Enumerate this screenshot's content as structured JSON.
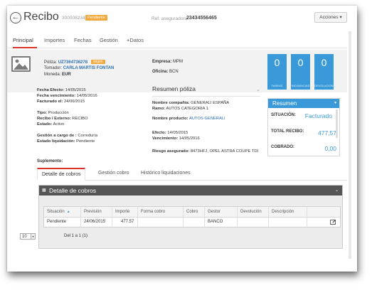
{
  "header": {
    "back_glyph": "←",
    "title": "Recibo",
    "doc_id": "3000082346",
    "state_badge": "Pendiente",
    "ref_label": "Ref. aseguradora",
    "ref_value": "23434556465",
    "actions_label": "Acciones"
  },
  "tabs": [
    {
      "label": "Principal",
      "active": true
    },
    {
      "label": "Importes",
      "active": false
    },
    {
      "label": "Fechas",
      "active": false
    },
    {
      "label": "Gestión",
      "active": false
    },
    {
      "label": "+Datos",
      "active": false
    }
  ],
  "summary": {
    "poliza_label": "Póliza:",
    "poliza_value": "UZ7364736278",
    "poliza_badge": "origen",
    "tomador_label": "Tomador:",
    "tomador_value": "CARLA MARTIS FONTAN",
    "moneda_label": "Moneda:",
    "moneda_value": "EUR",
    "empresa_label": "Empresa:",
    "empresa_value": "MPM",
    "oficina_label": "Oficina:",
    "oficina_value": "BCN",
    "tiles": [
      {
        "value": "0",
        "caption": "TAREAS"
      },
      {
        "value": "0",
        "caption": "INCIDENCIAS"
      },
      {
        "value": "0",
        "caption": "DEVOLUCIONES"
      }
    ]
  },
  "dates": {
    "efecto_label": "Fecha Efecto:",
    "efecto_value": "14/05/2015",
    "vencimiento_label": "Fecha vencimiento:",
    "vencimiento_value": "14/05/2016",
    "facturado_label": "Facturado el:",
    "facturado_value": "24/06/2015"
  },
  "status": {
    "tipo_label": "Tipo:",
    "tipo_value": "Producción",
    "recibo_label": "Recibo / Externo:",
    "recibo_value": "RECIBO",
    "estado_label": "Estado:",
    "estado_value": "Activo",
    "gestion_label": "Gestión a cargo de :",
    "gestion_value": "Correduría",
    "liquidacion_label": "Estado liquidación:",
    "liquidacion_value": "Pendiente"
  },
  "poliza_summary": {
    "title": "Resumen póliza",
    "compania_label": "Nombre compañía:",
    "compania_value": "GENERALI ESPAÑA",
    "ramo_label": "Ramo:",
    "ramo_value": "AUTOS CATEGORIA 1",
    "producto_label": "Nombre producto:",
    "producto_value": "AUTOS GENERALI",
    "efecto_label": "Efecto:",
    "efecto_value": "14/05/2015",
    "vencimiento_label": "Vencimiento:",
    "vencimiento_value": "14/05/2016",
    "riesgo_label": "Riesgo asegurado:",
    "riesgo_value": "8473HFJ, OPEL ASTRA COUPE TDI"
  },
  "resumen": {
    "title": "Resumen",
    "situacion_label": "SITUACIÓN:",
    "situacion_value": "Facturado",
    "total_label": "TOTAL RECIBO:",
    "total_value": "477,57",
    "cobrado_label": "COBRADO:",
    "cobrado_value": "0,00"
  },
  "suplemento_label": "Suplemento:",
  "subtabs": [
    {
      "label": "Detalle de cobros",
      "active": true
    },
    {
      "label": "Gestión cobro",
      "active": false
    },
    {
      "label": "Histórico liquidaciones",
      "active": false
    }
  ],
  "cobros": {
    "title": "Detalle de cobros",
    "columns": [
      "Situación",
      "Previsión",
      "Importe",
      "Forma cobro",
      "Cobro",
      "Gestor",
      "Devolución",
      "Descripción",
      ""
    ],
    "rows": [
      [
        "Pendiente",
        "24/06/2015",
        "477.57",
        "",
        "",
        "BANCO",
        "",
        "",
        ""
      ]
    ],
    "page_size": "10",
    "page_info": "Del 1 a 1 (1)"
  },
  "colors": {
    "accent_red": "#d9342b",
    "tile_blue": "#3a9ad9",
    "badge_orange": "#f0a93b",
    "link_blue": "#2a6fb5",
    "panel_header": "#555555"
  }
}
